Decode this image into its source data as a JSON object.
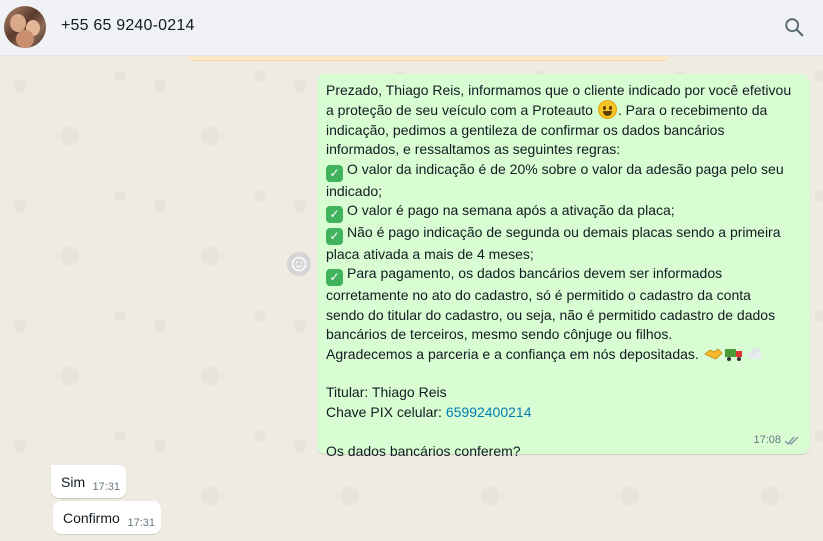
{
  "header": {
    "contact_name": "+55 65 9240-0214",
    "search_icon": "search-icon"
  },
  "colors": {
    "outgoing_bubble": "#d9fdd3",
    "incoming_bubble": "#ffffff",
    "chat_background": "#efeae2",
    "header_background": "#f0f2f5",
    "link": "#027eb5"
  },
  "messages": {
    "outgoing": {
      "line1": "Prezado, Thiago Reis, informamos que o cliente indicado por você efetivou",
      "line2a": "a proteção de seu veículo com a Proteauto ",
      "line2b": ". Para o recebimento da",
      "line3": "indicação, pedimos a gentileza de confirmar os dados bancários",
      "line4": "informados, e  ressaltamos as seguintes regras:",
      "rule1a": "O valor da indicação é de 20% sobre o valor da adesão paga pelo seu",
      "rule1b": "indicado;",
      "rule2": "O valor é pago na semana após a ativação da placa;",
      "rule3a": "Não é pago indicação de segunda ou demais placas sendo a primeira",
      "rule3b": "placa ativada a mais de 4 meses;",
      "rule4a": "Para pagamento, os dados bancários devem ser informados",
      "rule4b": "corretamente no ato do cadastro, só é permitido o cadastro da conta",
      "rule4c": "sendo do titular do cadastro, ou seja, não é permitido cadastro de dados",
      "rule4d": "bancários de terceiros, mesmo sendo cônjuge ou filhos.",
      "thanks": "Agradecemos a parceria e a confiança em nós depositadas. ",
      "titular": "Titular: Thiago Reis",
      "pix_label": "Chave PIX celular: ",
      "pix_value": "65992400214",
      "question": "Os dados bancários conferem?",
      "time": "17:08",
      "status_icon": "double-check-icon"
    },
    "incoming": [
      {
        "text": "Sim",
        "time": "17:31"
      },
      {
        "text": "Confirmo",
        "time": "17:31"
      }
    ]
  }
}
